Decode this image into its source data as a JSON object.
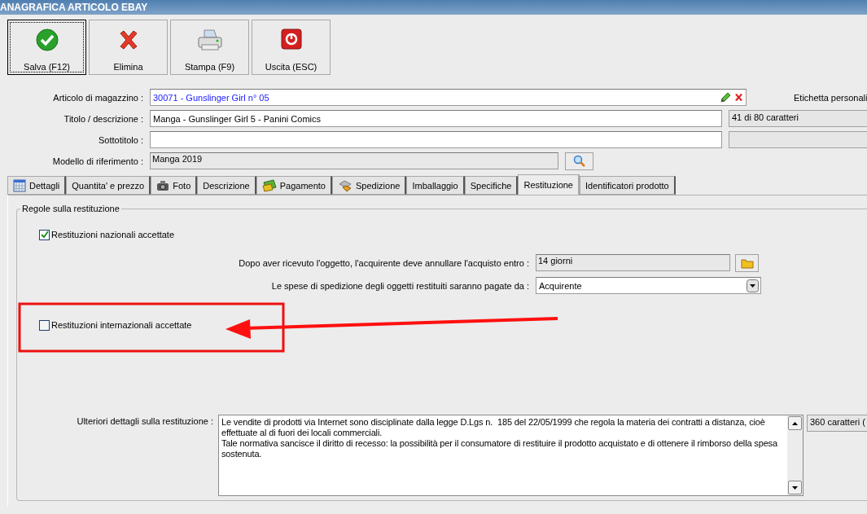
{
  "window": {
    "title": "ANAGRAFICA ARTICOLO EBAY"
  },
  "toolbar": [
    {
      "label": "Salva (F12)",
      "kind": "save",
      "selected": true
    },
    {
      "label": "Elimina",
      "kind": "delete",
      "selected": false
    },
    {
      "label": "Stampa (F9)",
      "kind": "print",
      "selected": false
    },
    {
      "label": "Uscita (ESC)",
      "kind": "exit",
      "selected": false
    }
  ],
  "form": {
    "item": {
      "label": "Articolo di magazzino :",
      "value": "30071 - Gunslinger Girl n° 05"
    },
    "custom_label": "Etichetta personali",
    "title": {
      "label": "Titolo / descrizione :",
      "value": "Manga - Gunslinger Girl 5 - Panini Comics",
      "counter": "41 di 80 caratteri"
    },
    "subtitle": {
      "label": "Sottotitolo :"
    },
    "template": {
      "label": "Modello di riferimento :",
      "value": "Manga 2019"
    }
  },
  "tabs": [
    {
      "label": "Dettagli",
      "kind": "calendar",
      "selected": false
    },
    {
      "label": "Quantita' e prezzo",
      "kind": "plain",
      "selected": false
    },
    {
      "label": "Foto",
      "kind": "camera",
      "selected": false
    },
    {
      "label": "Descrizione",
      "kind": "plain",
      "selected": false
    },
    {
      "label": "Pagamento",
      "kind": "money",
      "selected": false
    },
    {
      "label": "Spedizione",
      "kind": "box",
      "selected": false
    },
    {
      "label": "Imballaggio",
      "kind": "plain",
      "selected": false
    },
    {
      "label": "Specifiche",
      "kind": "plain",
      "selected": false
    },
    {
      "label": "Restituzione",
      "kind": "plain",
      "selected": true
    },
    {
      "label": "Identificatori prodotto",
      "kind": "plain",
      "selected": false
    }
  ],
  "returns": {
    "group_title": "Regole sulla restituzione",
    "domestic": {
      "label": "Restituzioni nazionali accettate",
      "checked": true
    },
    "return_within": {
      "label": "Dopo aver ricevuto l'oggetto, l'acquirente deve annullare l'acquisto entro :",
      "value": "14 giorni"
    },
    "shipping_paid_by": {
      "label": "Le spese di spedizione degli oggetti restituiti saranno pagate da :",
      "value": "Acquirente"
    },
    "international": {
      "label": "Restituzioni internazionali accettate",
      "checked": false
    },
    "details": {
      "label": "Ulteriori dettagli sulla restituzione :",
      "value": "Le vendite di prodotti via Internet sono disciplinate dalla legge D.Lgs n.  185 del 22/05/1999 che regola la materia dei contratti a distanza, cioè effettuate al di fuori dei locali commerciali.\nTale normativa sancisce il diritto di recesso: la possibilità per il consumatore di restituire il prodotto acquistato e di ottenere il rimborso della spesa sostenuta.",
      "counter": "360 caratteri ("
    }
  }
}
